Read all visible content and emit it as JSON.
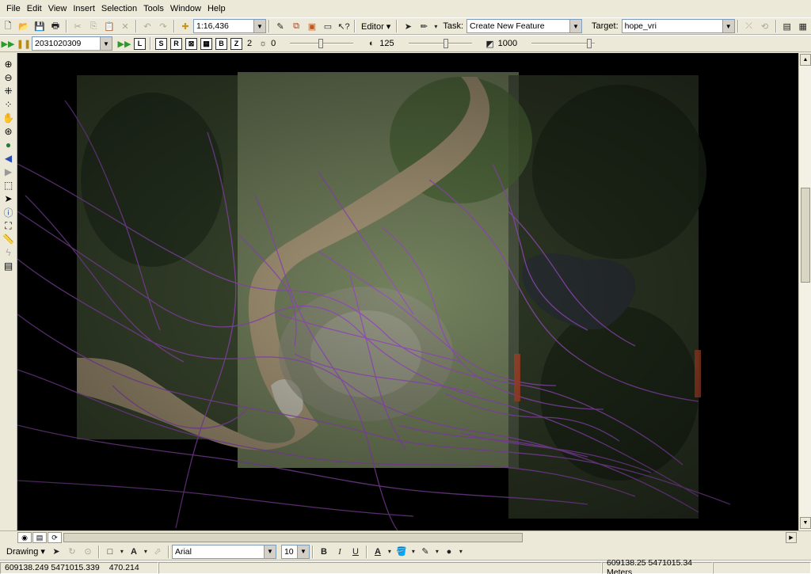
{
  "menu": [
    {
      "label": "File"
    },
    {
      "label": "Edit"
    },
    {
      "label": "View"
    },
    {
      "label": "Insert"
    },
    {
      "label": "Selection"
    },
    {
      "label": "Tools"
    },
    {
      "label": "Window"
    },
    {
      "label": "Help"
    }
  ],
  "standard_toolbar": {
    "scale_value": "1:16,436",
    "editor_label": "Editor",
    "task_label": "Task:",
    "task_value": "Create New Feature",
    "target_label": "Target:",
    "target_value": "hope_vri"
  },
  "effects_toolbar": {
    "date_value": "2031020309",
    "layer_count": "2",
    "brightness_value": "0",
    "contrast_value": "125",
    "transparency_value": "1000"
  },
  "drawing_toolbar": {
    "drawing_label": "Drawing",
    "font_value": "Arial",
    "size_value": "10",
    "bold_label": "B",
    "italic_label": "I",
    "underline_label": "U",
    "font_color_label": "A"
  },
  "status_bar": {
    "left_coords": "609138.249  5471015.339",
    "left_value": "470.214",
    "right_coords": "609138.25  5471015.34 Meters"
  },
  "colors": {
    "chrome": "#ECE9D8",
    "polyline": "#9b4fc1",
    "map_background": "#000000"
  }
}
